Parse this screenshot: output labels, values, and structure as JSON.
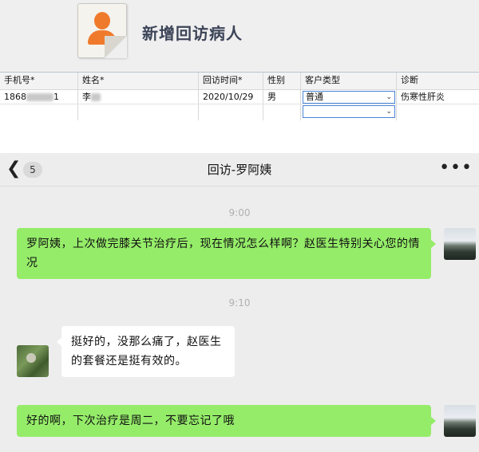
{
  "form": {
    "title": "新增回访病人",
    "columns": [
      "手机号*",
      "姓名*",
      "回访时间*",
      "性别",
      "客户类型",
      "诊断"
    ],
    "row1": {
      "phone_prefix": "1868",
      "phone_suffix": "1",
      "name_prefix": "李",
      "date": "2020/10/29",
      "gender": "男",
      "customer_type": "普通",
      "diagnosis": "伤寒性肝炎"
    },
    "row2": {
      "customer_type": ""
    }
  },
  "chat": {
    "unread_count": "5",
    "title": "回访-罗阿姨",
    "messages": [
      {
        "time": "9:00"
      },
      {
        "from": "me",
        "text": "罗阿姨，上次做完膝关节治疗后，现在情况怎么样啊？赵医生特别关心您的情况"
      },
      {
        "time": "9:10"
      },
      {
        "from": "them",
        "text": "挺好的，没那么痛了，赵医生的套餐还是挺有效的。"
      },
      {
        "from": "me",
        "text": "好的啊，下次治疗是周二，不要忘记了哦"
      }
    ]
  },
  "icons": {
    "form_icon": "patient-card-icon",
    "back": "chevron-left-icon",
    "more": "more-dots-icon",
    "dropdown": "chevron-down-icon"
  },
  "colors": {
    "my_bubble": "#95ec69",
    "their_bubble": "#ffffff",
    "chat_bg": "#ededed",
    "person_icon": "#f07a2c",
    "title_text": "#3c4457"
  }
}
